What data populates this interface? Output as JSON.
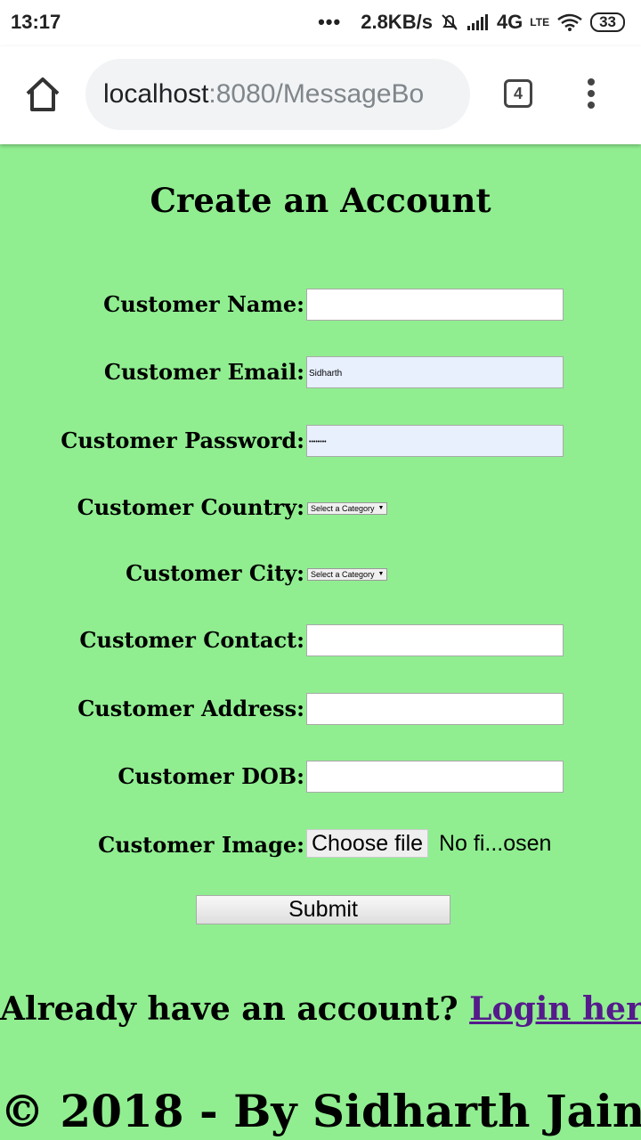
{
  "status_bar": {
    "time": "13:17",
    "dots": "•••",
    "net_speed": "2.8KB/s",
    "network": "4G",
    "lte": "LTE",
    "battery": "33"
  },
  "browser": {
    "url_host": "localhost",
    "url_path": ":8080/MessageBo",
    "tab_count": "4"
  },
  "page": {
    "title": "Create an Account",
    "fields": {
      "name": {
        "label": "Customer Name:",
        "value": ""
      },
      "email": {
        "label": "Customer Email:",
        "value": "Sidharth"
      },
      "password": {
        "label": "Customer Password:",
        "value": "••••••••"
      },
      "country": {
        "label": "Customer Country:",
        "selected": "Select a Category"
      },
      "city": {
        "label": "Customer City:",
        "selected": "Select a Category"
      },
      "contact": {
        "label": "Customer Contact:",
        "value": ""
      },
      "address": {
        "label": "Customer Address:",
        "value": ""
      },
      "dob": {
        "label": "Customer DOB:",
        "value": ""
      },
      "image": {
        "label": "Customer Image:",
        "button": "Choose file",
        "filename": "No fi...osen"
      }
    },
    "submit_label": "Submit",
    "login_prompt": "Already have an account?",
    "login_link": "Login here",
    "footer": "© 2018 - By Sidharth Jain",
    "background_color": "#90ee90"
  }
}
